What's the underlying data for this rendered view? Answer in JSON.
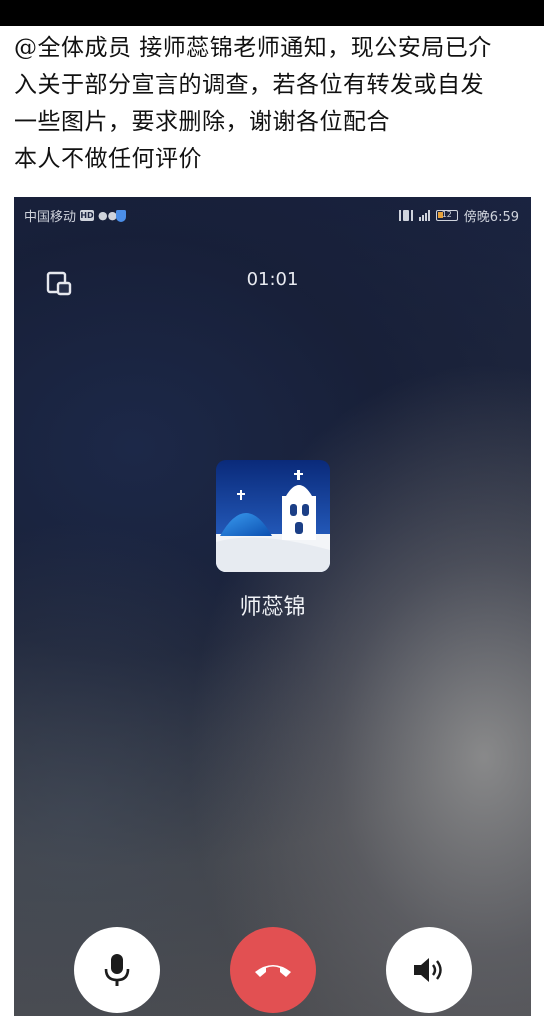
{
  "notice": {
    "lines": [
      "@全体成员 接师蕊锦老师通知，现公安局已介",
      "入关于部分宣言的调查，若各位有转发或自发",
      "一些图片，要求删除，谢谢各位配合",
      "本人不做任何评价"
    ]
  },
  "status_bar": {
    "carrier": "中国移动",
    "hd_badge": "HD",
    "battery_level": "12",
    "time": "傍晚6:59"
  },
  "call": {
    "timer": "01:01",
    "caller_name": "师蕊锦"
  },
  "icons": {
    "minimize": "minimize-window-icon",
    "mic": "microphone-icon",
    "hangup": "hang-up-phone-icon",
    "speaker": "speaker-icon",
    "wechat": "wechat-icon",
    "shield": "shield-icon",
    "vibrate": "vibrate-icon",
    "signal": "signal-icon",
    "battery": "battery-icon"
  },
  "colors": {
    "hangup": "#e25052",
    "control_bg": "#ffffff",
    "battery_fill": "#e6a23c"
  }
}
